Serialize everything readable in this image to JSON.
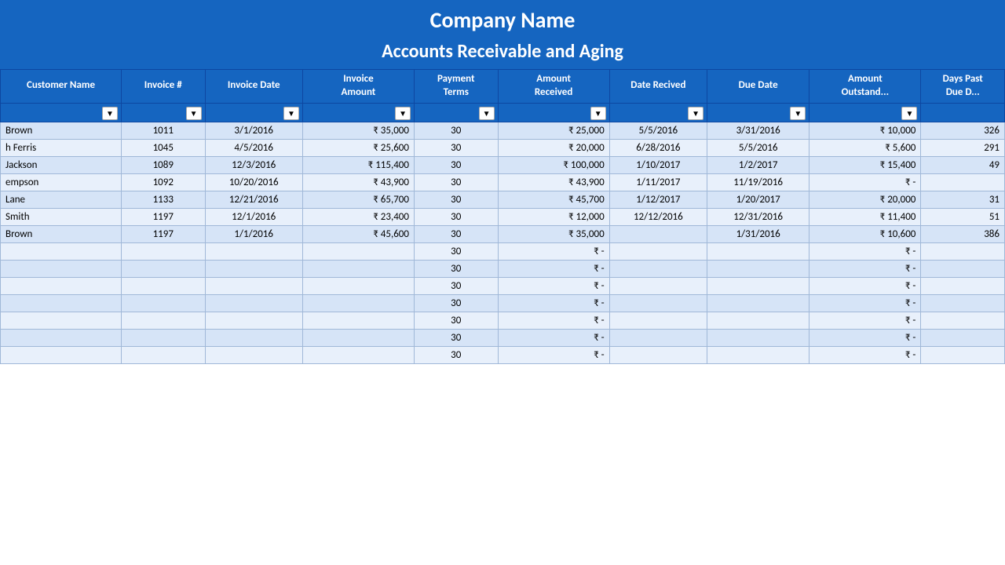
{
  "header": {
    "company_name": "Company Name",
    "subtitle": "Accounts Receivable and Aging"
  },
  "columns": [
    {
      "key": "customer",
      "label": "Customer Name",
      "class": "col-customer"
    },
    {
      "key": "invoice_num",
      "label": "Invoice #",
      "class": "col-invoice-num"
    },
    {
      "key": "invoice_date",
      "label": "Invoice Date",
      "class": "col-invoice-date"
    },
    {
      "key": "invoice_amount",
      "label": "Invoice Amount",
      "class": "col-invoice-amount"
    },
    {
      "key": "payment_terms",
      "label": "Payment Terms",
      "class": "col-payment-terms"
    },
    {
      "key": "amount_received",
      "label": "Amount Received",
      "class": "col-amount-received"
    },
    {
      "key": "date_received",
      "label": "Date Recived",
      "class": "col-date-received"
    },
    {
      "key": "due_date",
      "label": "Due Date",
      "class": "col-due-date"
    },
    {
      "key": "amount_outstanding",
      "label": "Amount Outstand...",
      "class": "col-amount-outstanding"
    },
    {
      "key": "days_due",
      "label": "Days Past Due D...",
      "class": "col-days-due"
    }
  ],
  "rows": [
    {
      "customer": "Brown",
      "invoice_num": "1011",
      "invoice_date": "3/1/2016",
      "invoice_amount": "₹   35,000",
      "payment_terms": "30",
      "amount_received": "₹   25,000",
      "date_received": "5/5/2016",
      "due_date": "3/31/2016",
      "amount_outstanding": "₹   10,000",
      "days_due": "326"
    },
    {
      "customer": "h Ferris",
      "invoice_num": "1045",
      "invoice_date": "4/5/2016",
      "invoice_amount": "₹   25,600",
      "payment_terms": "30",
      "amount_received": "₹   20,000",
      "date_received": "6/28/2016",
      "due_date": "5/5/2016",
      "amount_outstanding": "₹     5,600",
      "days_due": "291"
    },
    {
      "customer": "Jackson",
      "invoice_num": "1089",
      "invoice_date": "12/3/2016",
      "invoice_amount": "₹ 115,400",
      "payment_terms": "30",
      "amount_received": "₹ 100,000",
      "date_received": "1/10/2017",
      "due_date": "1/2/2017",
      "amount_outstanding": "₹   15,400",
      "days_due": "49"
    },
    {
      "customer": "empson",
      "invoice_num": "1092",
      "invoice_date": "10/20/2016",
      "invoice_amount": "₹   43,900",
      "payment_terms": "30",
      "amount_received": "₹   43,900",
      "date_received": "1/11/2017",
      "due_date": "11/19/2016",
      "amount_outstanding": "₹          -",
      "days_due": ""
    },
    {
      "customer": "Lane",
      "invoice_num": "1133",
      "invoice_date": "12/21/2016",
      "invoice_amount": "₹   65,700",
      "payment_terms": "30",
      "amount_received": "₹   45,700",
      "date_received": "1/12/2017",
      "due_date": "1/20/2017",
      "amount_outstanding": "₹   20,000",
      "days_due": "31"
    },
    {
      "customer": "Smith",
      "invoice_num": "1197",
      "invoice_date": "12/1/2016",
      "invoice_amount": "₹   23,400",
      "payment_terms": "30",
      "amount_received": "₹   12,000",
      "date_received": "12/12/2016",
      "due_date": "12/31/2016",
      "amount_outstanding": "₹   11,400",
      "days_due": "51"
    },
    {
      "customer": "Brown",
      "invoice_num": "1197",
      "invoice_date": "1/1/2016",
      "invoice_amount": "₹   45,600",
      "payment_terms": "30",
      "amount_received": "₹   35,000",
      "date_received": "",
      "due_date": "1/31/2016",
      "amount_outstanding": "₹   10,600",
      "days_due": "386"
    },
    {
      "customer": "",
      "invoice_num": "",
      "invoice_date": "",
      "invoice_amount": "",
      "payment_terms": "30",
      "amount_received": "₹          -",
      "date_received": "",
      "due_date": "",
      "amount_outstanding": "₹          -",
      "days_due": ""
    },
    {
      "customer": "",
      "invoice_num": "",
      "invoice_date": "",
      "invoice_amount": "",
      "payment_terms": "30",
      "amount_received": "₹          -",
      "date_received": "",
      "due_date": "",
      "amount_outstanding": "₹          -",
      "days_due": ""
    },
    {
      "customer": "",
      "invoice_num": "",
      "invoice_date": "",
      "invoice_amount": "",
      "payment_terms": "30",
      "amount_received": "₹          -",
      "date_received": "",
      "due_date": "",
      "amount_outstanding": "₹          -",
      "days_due": ""
    },
    {
      "customer": "",
      "invoice_num": "",
      "invoice_date": "",
      "invoice_amount": "",
      "payment_terms": "30",
      "amount_received": "₹          -",
      "date_received": "",
      "due_date": "",
      "amount_outstanding": "₹          -",
      "days_due": ""
    },
    {
      "customer": "",
      "invoice_num": "",
      "invoice_date": "",
      "invoice_amount": "",
      "payment_terms": "30",
      "amount_received": "₹          -",
      "date_received": "",
      "due_date": "",
      "amount_outstanding": "₹          -",
      "days_due": ""
    },
    {
      "customer": "",
      "invoice_num": "",
      "invoice_date": "",
      "invoice_amount": "",
      "payment_terms": "30",
      "amount_received": "₹          -",
      "date_received": "",
      "due_date": "",
      "amount_outstanding": "₹          -",
      "days_due": ""
    },
    {
      "customer": "",
      "invoice_num": "",
      "invoice_date": "",
      "invoice_amount": "",
      "payment_terms": "30",
      "amount_received": "₹          -",
      "date_received": "",
      "due_date": "",
      "amount_outstanding": "₹          -",
      "days_due": ""
    }
  ],
  "filter_btn_label": "▼"
}
